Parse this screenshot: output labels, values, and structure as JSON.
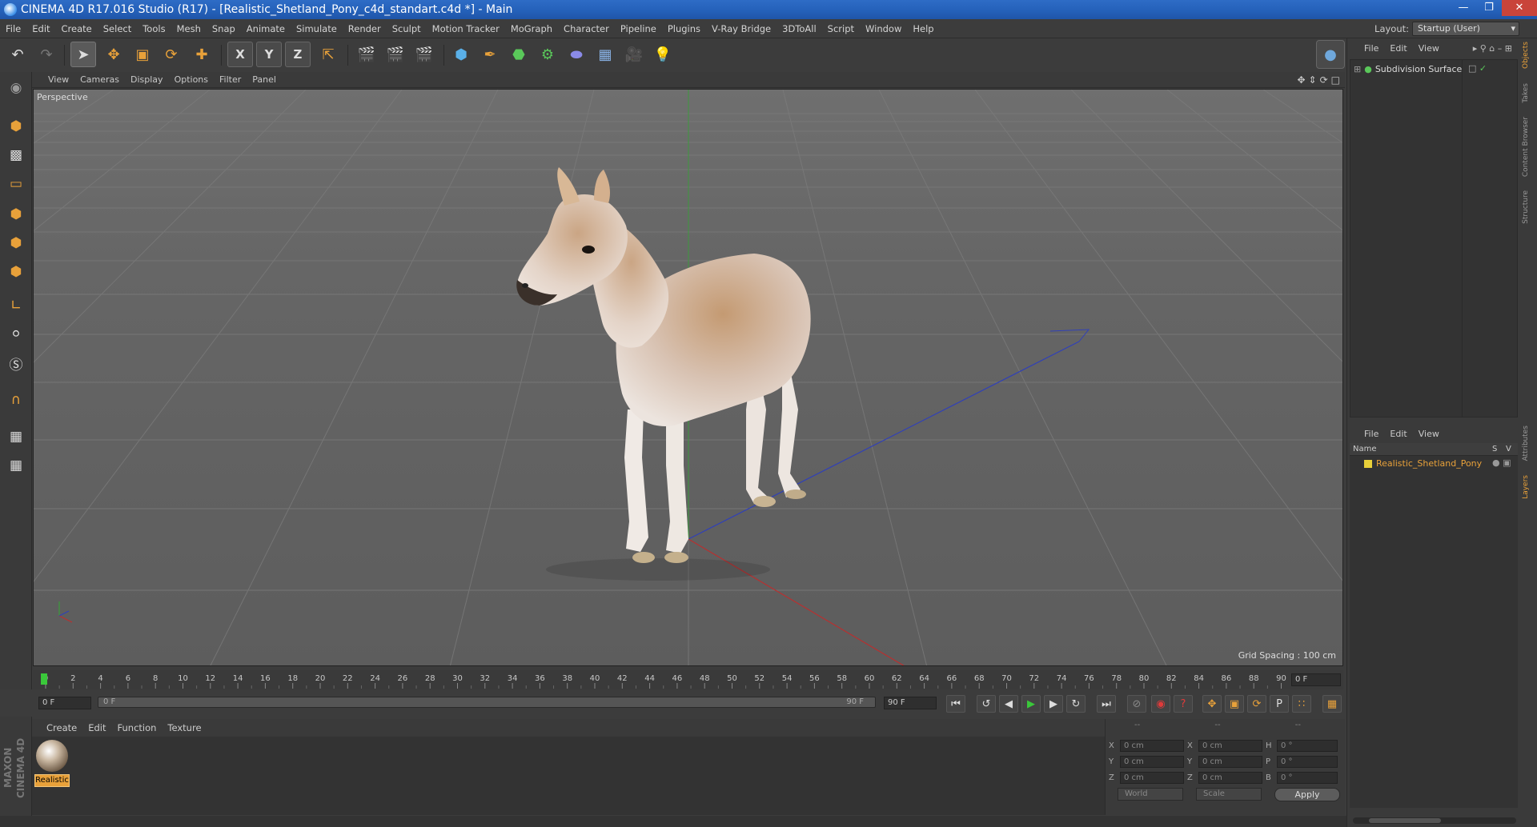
{
  "window": {
    "title": "CINEMA 4D R17.016 Studio (R17) - [Realistic_Shetland_Pony_c4d_standart.c4d *] - Main"
  },
  "menu": [
    "File",
    "Edit",
    "Create",
    "Select",
    "Tools",
    "Mesh",
    "Snap",
    "Animate",
    "Simulate",
    "Render",
    "Sculpt",
    "Motion Tracker",
    "MoGraph",
    "Character",
    "Pipeline",
    "Plugins",
    "V-Ray Bridge",
    "3DToAll",
    "Script",
    "Window",
    "Help"
  ],
  "layout": {
    "label": "Layout:",
    "value": "Startup (User)"
  },
  "toolbar": {
    "axis_x": "X",
    "axis_y": "Y",
    "axis_z": "Z"
  },
  "viewport": {
    "menu": [
      "View",
      "Cameras",
      "Display",
      "Options",
      "Filter",
      "Panel"
    ],
    "label": "Perspective",
    "grid_spacing": "Grid Spacing : 100 cm"
  },
  "timeline": {
    "ticks": [
      "0",
      "2",
      "4",
      "6",
      "8",
      "10",
      "12",
      "14",
      "16",
      "18",
      "20",
      "22",
      "24",
      "26",
      "28",
      "30",
      "32",
      "34",
      "36",
      "38",
      "40",
      "42",
      "44",
      "46",
      "48",
      "50",
      "52",
      "54",
      "56",
      "58",
      "60",
      "62",
      "64",
      "66",
      "68",
      "70",
      "72",
      "74",
      "76",
      "78",
      "80",
      "82",
      "84",
      "86",
      "88",
      "90"
    ],
    "current_frame": "0 F",
    "start_frame": "0 F",
    "range_start": "0 F",
    "range_end": "90 F",
    "end_frame": "90 F"
  },
  "material_manager": {
    "menu": [
      "Create",
      "Edit",
      "Function",
      "Texture"
    ],
    "materials": [
      {
        "name": "Realistic"
      }
    ]
  },
  "brand": {
    "text": "MAXON CINEMA 4D"
  },
  "coordinates": {
    "header": [
      "--",
      "--",
      "--"
    ],
    "rows": [
      {
        "l1": "X",
        "v1": "0 cm",
        "l2": "X",
        "v2": "0 cm",
        "l3": "H",
        "v3": "0 °"
      },
      {
        "l1": "Y",
        "v1": "0 cm",
        "l2": "Y",
        "v2": "0 cm",
        "l3": "P",
        "v3": "0 °"
      },
      {
        "l1": "Z",
        "v1": "0 cm",
        "l2": "Z",
        "v2": "0 cm",
        "l3": "B",
        "v3": "0 °"
      }
    ],
    "space": "World",
    "mode": "Scale",
    "apply": "Apply"
  },
  "object_manager": {
    "menu": [
      "File",
      "Edit",
      "View"
    ],
    "items": [
      {
        "name": "Subdivision Surface"
      }
    ]
  },
  "layer_manager": {
    "menu": [
      "File",
      "Edit",
      "View"
    ],
    "columns": {
      "name": "Name",
      "s": "S",
      "v": "V"
    },
    "items": [
      {
        "name": "Realistic_Shetland_Pony",
        "color": "#e8d03a"
      }
    ]
  },
  "side_tabs": [
    "Objects",
    "Takes",
    "Content Browser",
    "Structure",
    "Attributes",
    "Layers"
  ],
  "colors": {
    "accent": "#e8a13a",
    "title_bar": "#2460b8",
    "x_axis": "#c03030",
    "y_axis": "#30a030",
    "z_axis": "#3040c0"
  }
}
